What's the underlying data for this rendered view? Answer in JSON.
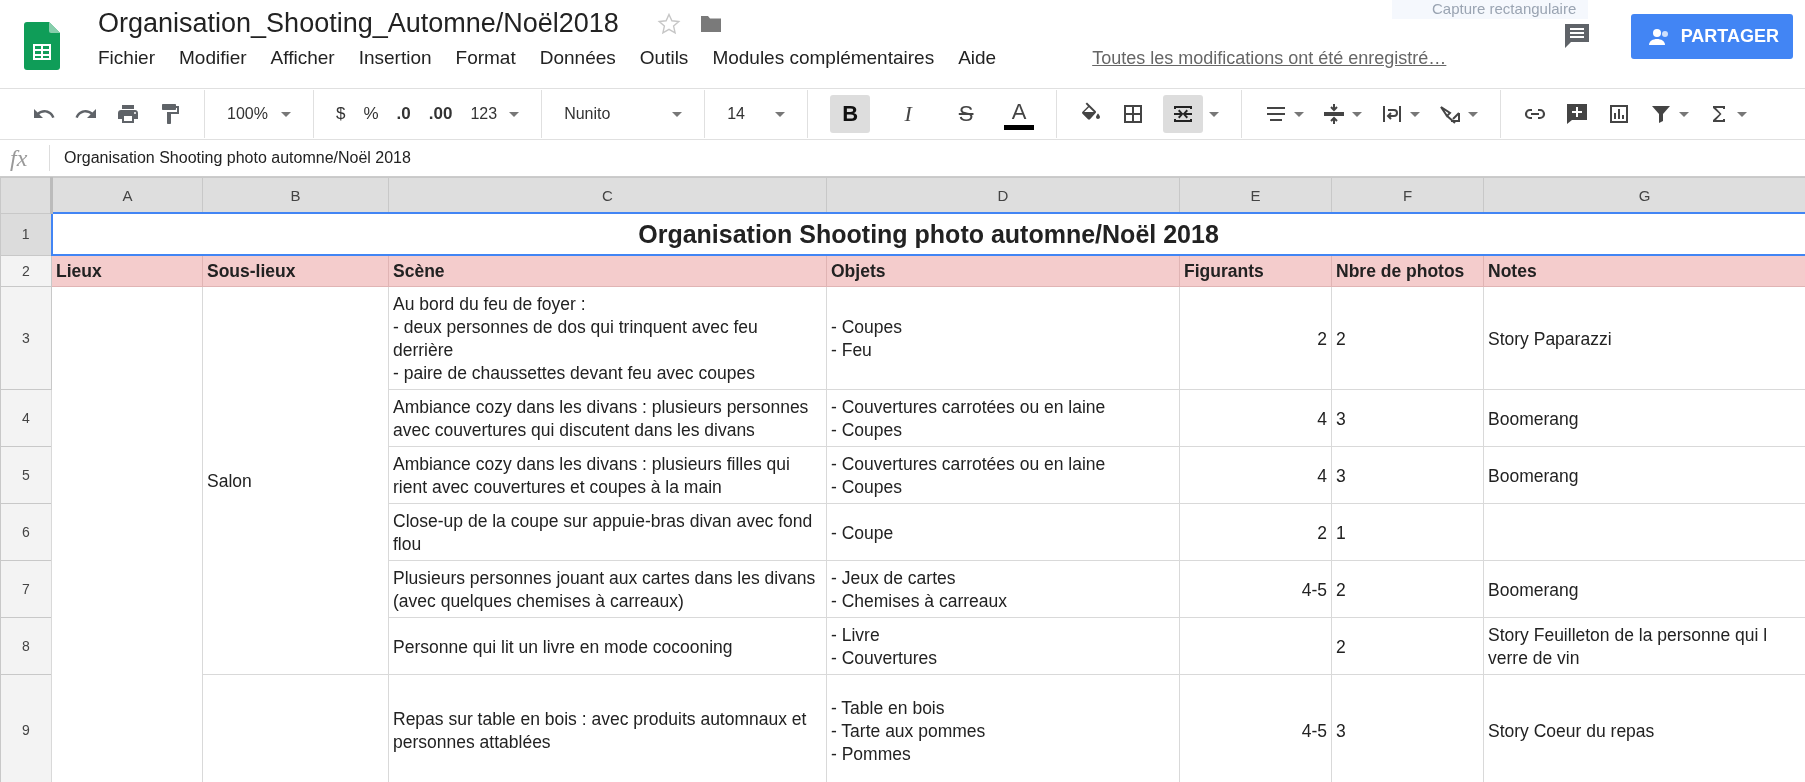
{
  "overlay_hint": "Capture rectangulaire",
  "document": {
    "title": "Organisation_Shooting_Automne/Noël2018",
    "starred": false,
    "save_status": "Toutes les modifications ont été enregistré…"
  },
  "menu": [
    "Fichier",
    "Modifier",
    "Afficher",
    "Insertion",
    "Format",
    "Données",
    "Outils",
    "Modules complémentaires",
    "Aide"
  ],
  "share_button": "PARTAGER",
  "toolbar": {
    "zoom": "100%",
    "currency": "$",
    "percent": "%",
    "decimal_decrease": ".0",
    "decimal_increase": ".00",
    "number_format": "123",
    "font": "Nunito",
    "font_size": "14",
    "text_buttons": [
      {
        "label": "B",
        "kind": "bold",
        "on": true
      },
      {
        "label": "I",
        "kind": "italic",
        "on": false
      },
      {
        "label": "S",
        "kind": "strike",
        "on": false
      },
      {
        "label": "A",
        "kind": "color",
        "on": false
      }
    ],
    "merge_on": true
  },
  "formula_bar": {
    "label": "fx",
    "value": "Organisation Shooting photo automne/Noël 2018"
  },
  "columns": [
    "A",
    "B",
    "C",
    "D",
    "E",
    "F",
    "G"
  ],
  "title_row": {
    "number": "1",
    "text": "Organisation Shooting photo automne/Noël 2018",
    "selected": true
  },
  "header_row": {
    "number": "2",
    "cells": [
      "Lieux",
      "Sous-lieux",
      "Scène",
      "Objets",
      "Figurants",
      "Nbre de photos",
      "Notes"
    ]
  },
  "lieux": [
    {
      "sous_lieux": [
        {
          "name": "Salon",
          "scenes": [
            {
              "row": "3",
              "scene": "Au bord du feu de foyer :\n- deux personnes de dos qui trinquent avec feu derrière\n- paire de chaussettes devant feu avec coupes",
              "objets": "- Coupes\n- Feu",
              "figurants": "2",
              "photos": "2",
              "notes": "Story Paparazzi"
            },
            {
              "row": "4",
              "scene": "Ambiance cozy dans les divans : plusieurs personnes avec couvertures qui discutent dans les divans",
              "objets": "- Couvertures carrotées ou en laine\n- Coupes",
              "figurants": "4",
              "photos": "3",
              "notes": "Boomerang"
            },
            {
              "row": "5",
              "scene": "Ambiance cozy dans les divans : plusieurs filles qui rient avec couvertures et coupes à la main",
              "objets": "- Couvertures carrotées ou en laine\n- Coupes",
              "figurants": "4",
              "photos": "3",
              "notes": "Boomerang"
            },
            {
              "row": "6",
              "scene": "Close-up de la coupe sur appuie-bras divan avec fond flou",
              "objets": "- Coupe",
              "figurants": "2",
              "photos": "1"
            },
            {
              "row": "7",
              "scene": "Plusieurs personnes jouant aux cartes dans les divans (avec quelques chemises à carreaux)",
              "objets": "- Jeux de cartes\n- Chemises à carreaux",
              "figurants": "4-5",
              "photos": "2",
              "notes": "Boomerang"
            },
            {
              "row": "8",
              "scene": "Personne qui lit un livre en mode cocooning",
              "objets": "- Livre\n- Couvertures",
              "photos": "2",
              "notes": "Story Feuilleton de la personne qui l\nverre de vin"
            }
          ]
        },
        {
          "scenes": [
            {
              "row": "9",
              "scene": "Repas sur table en bois : avec produits automnaux et personnes attablées",
              "objets": "- Table en bois\n- Tarte aux pommes\n- Pommes",
              "figurants": "4-5",
              "photos": "3",
              "notes": "Story Coeur du repas"
            }
          ]
        }
      ]
    }
  ]
}
